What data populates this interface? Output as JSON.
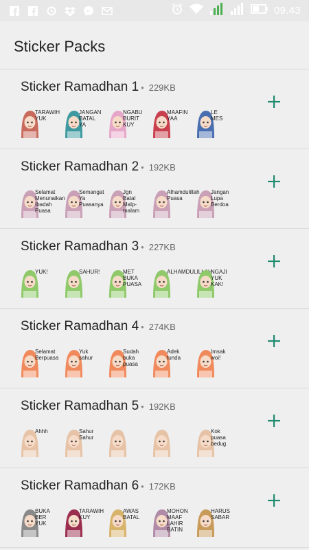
{
  "status": {
    "time": "09.43"
  },
  "page": {
    "title": "Sticker Packs"
  },
  "packs": [
    {
      "name": "Sticker Ramadhan 1",
      "size": "229KB",
      "captions": [
        "TARAWIH YUK",
        "JANGAN BATAL YA",
        "NGABU BURIT KUY",
        "MAAFIN YAA",
        "LE MES"
      ],
      "scarf": [
        "#c96b5c",
        "#3e9aa0",
        "#e6a6c8",
        "#c9404f",
        "#4a6fb0"
      ]
    },
    {
      "name": "Sticker Ramadhan 2",
      "size": "192KB",
      "captions": [
        "Selamat Menunaikan Ibadah Puasa",
        "Semangat Ya Puasanya",
        "Jgn Batal Malp-malam",
        "Alhamdulillah Puasa",
        "Jangan Lupa Berdoa"
      ],
      "scarf": [
        "#c9a0b6",
        "#c9a0b6",
        "#c9a0b6",
        "#c9a0b6",
        "#c9a0b6"
      ]
    },
    {
      "name": "Sticker Ramadhan 3",
      "size": "227KB",
      "captions": [
        "YUK!",
        "SAHUR!",
        "MET BUKA PUASA",
        "ALHAMDULILLAH",
        "NGAJI YUK KAK!"
      ],
      "scarf": [
        "#8fc96a",
        "#8fc96a",
        "#8fc96a",
        "#8fc96a",
        "#8fc96a"
      ]
    },
    {
      "name": "Sticker Ramadhan 4",
      "size": "274KB",
      "captions": [
        "Selamat Berpuasa",
        "Yuk sahur",
        "Sudah buka puasa",
        "Adek tunda",
        "Imsak woi!"
      ],
      "scarf": [
        "#f08a5d",
        "#f08a5d",
        "#f08a5d",
        "#f08a5d",
        "#f08a5d"
      ]
    },
    {
      "name": "Sticker Ramadhan 5",
      "size": "192KB",
      "captions": [
        "Ahhh",
        "Sahur Sahur",
        "",
        "",
        "Kok puasa bedug"
      ],
      "scarf": [
        "#e6c3a6",
        "#e6c3a6",
        "#e6c3a6",
        "#e6c3a6",
        "#e6c3a6"
      ]
    },
    {
      "name": "Sticker Ramadhan 6",
      "size": "172KB",
      "captions": [
        "BUKA BER YUK",
        "TARAWIH KUY",
        "AWAS BATAL",
        "MOHON MAAF LAHIR BATIN",
        "HARUS SABAR"
      ],
      "scarf": [
        "#8a8a8a",
        "#9b2d4f",
        "#d8b36a",
        "#b08aa6",
        "#c99b5a"
      ]
    }
  ],
  "icons": {
    "add": "plus-icon",
    "accent": "#1f8a70"
  }
}
